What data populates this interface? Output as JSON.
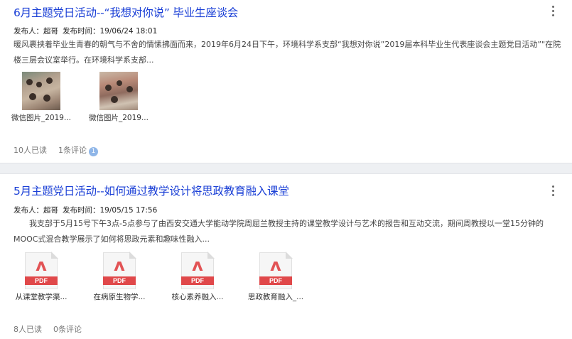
{
  "posts": [
    {
      "title": "6月主题党日活动--“我想对你说” 毕业生座谈会",
      "meta": {
        "publisher_label": "发布人：",
        "publisher": "超哥",
        "time_label": "发布时间：",
        "time": "19/06/24 18:01"
      },
      "summary": "暖风裹挟着毕业生青春的朝气与不舍的情愫拂面而来，2019年6月24日下午，环境科学系支部“我想对你说”2019届本科毕业生代表座谈会主题党日活动”\"在院楼三层会议室举行。在环境科学系支部...",
      "attachments": [
        {
          "type": "image",
          "caption": "微信图片_2019..."
        },
        {
          "type": "image",
          "caption": "微信图片_2019..."
        }
      ],
      "stats": {
        "reads": "10人已读",
        "comments": "1条评论",
        "badge": "1"
      }
    },
    {
      "title": "5月主题党日活动--如何通过教学设计将思政教育融入课堂",
      "meta": {
        "publisher_label": "发布人：",
        "publisher": "超哥",
        "time_label": "发布时间：",
        "time": "19/05/15 17:56"
      },
      "summary": "我支部于5月15号下午3点-5点参与了由西安交通大学能动学院周屈兰教授主持的课堂教学设计与艺术的报告和互动交流，期间周教授以一堂15分钟的MOOC式混合教学展示了如何将思政元素和趣味性融入...",
      "attachments": [
        {
          "type": "pdf",
          "label": "PDF",
          "caption": "从课堂教学渠..."
        },
        {
          "type": "pdf",
          "label": "PDF",
          "caption": "在病原生物学..."
        },
        {
          "type": "pdf",
          "label": "PDF",
          "caption": "核心素养融入..."
        },
        {
          "type": "pdf",
          "label": "PDF",
          "caption": "思政教育融入_..."
        }
      ],
      "stats": {
        "reads": "8人已读",
        "comments": "0条评论"
      }
    }
  ],
  "icons": {
    "more": "more-vertical-icon",
    "pdf": "pdf-file-icon"
  },
  "colors": {
    "title": "#1a3fd6",
    "badge": "#8fb6e8",
    "pdf_red": "#e0484a",
    "divider": "#eef0f3"
  }
}
